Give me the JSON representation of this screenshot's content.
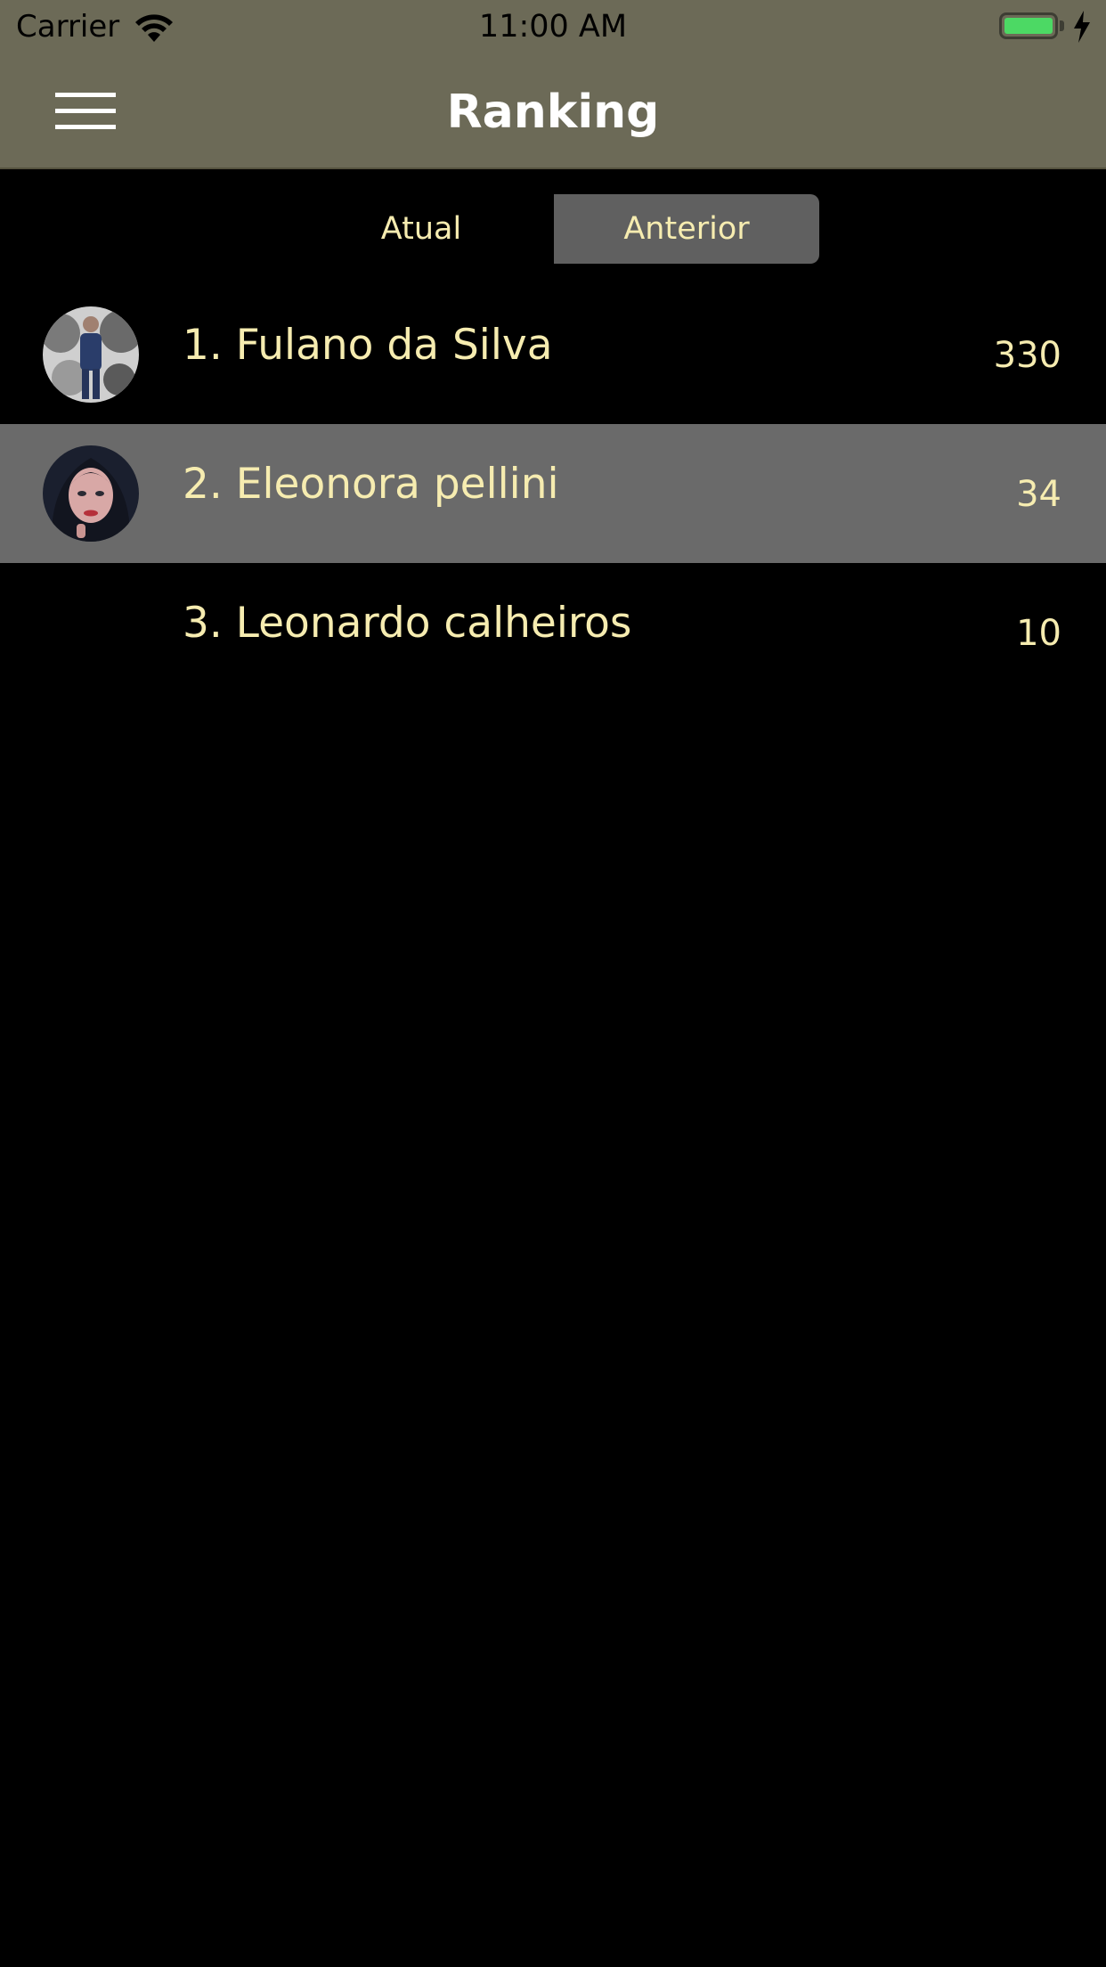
{
  "status_bar": {
    "carrier": "Carrier",
    "time": "11:00 AM"
  },
  "header": {
    "title": "Ranking",
    "menu_icon": "hamburger-icon"
  },
  "tabs": [
    {
      "label": "Atual",
      "selected": false
    },
    {
      "label": "Anterior",
      "selected": true
    }
  ],
  "ranking": [
    {
      "name": "1. Fulano da Silva",
      "score": "330",
      "avatar": "photo"
    },
    {
      "name": "2. Eleonora pellini",
      "score": "34",
      "avatar": "photo"
    },
    {
      "name": "3. Leonardo calheiros",
      "score": "10",
      "avatar": "none"
    }
  ],
  "colors": {
    "header_bg": "#6c6a57",
    "text_accent": "#f6ecb0",
    "selected_tab_bg": "#606060",
    "highlight_row_bg": "#6a6a6a",
    "background": "#000000"
  }
}
